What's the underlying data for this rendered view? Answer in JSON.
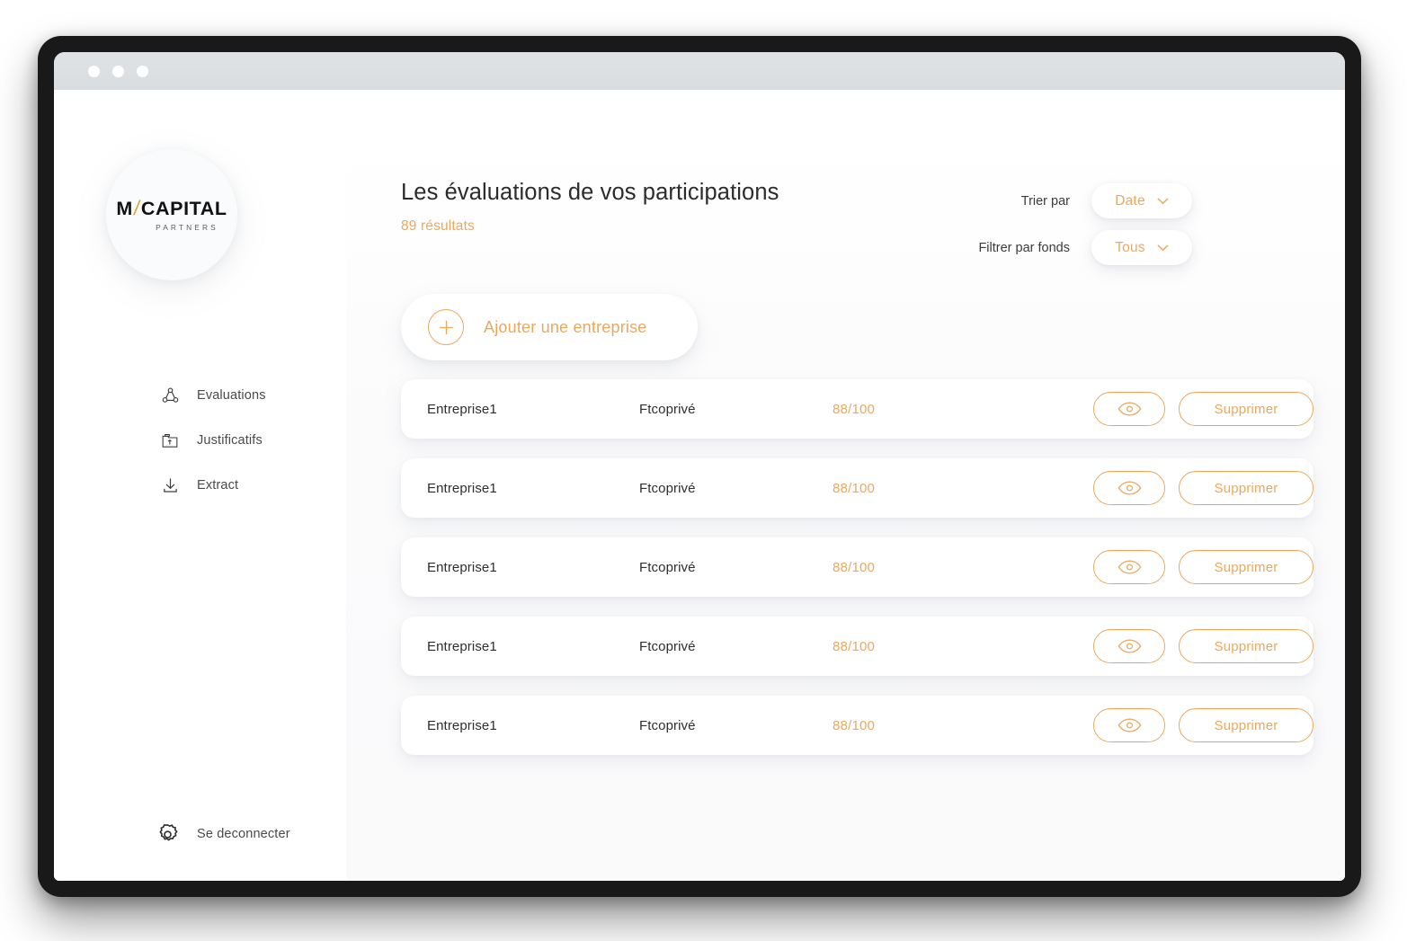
{
  "window": {
    "traffic_lights": [
      "close",
      "minimize",
      "maximize"
    ]
  },
  "brand": {
    "name_part1": "M",
    "slash": "/",
    "name_part2": "CAPITAL",
    "tagline": "PARTNERS",
    "slash_color": "#e0a13f"
  },
  "sidebar": {
    "items": [
      {
        "label": "Evaluations",
        "icon": "network-icon"
      },
      {
        "label": "Justificatifs",
        "icon": "folder-upload-icon"
      },
      {
        "label": "Extract",
        "icon": "download-icon"
      }
    ],
    "logout": {
      "label": "Se deconnecter",
      "icon": "gear-icon"
    }
  },
  "header": {
    "title": "Les évaluations de vos participations",
    "results": "89 résultats",
    "sort": {
      "label": "Trier par",
      "value": "Date"
    },
    "filter": {
      "label": "Filtrer par fonds",
      "value": "Tous"
    }
  },
  "actions": {
    "add_company": "Ajouter une entreprise"
  },
  "table": {
    "row_action_delete": "Supprimer",
    "rows": [
      {
        "name": "Entreprise1",
        "fund": "Ftcoprivé",
        "score": "88/100"
      },
      {
        "name": "Entreprise1",
        "fund": "Ftcoprivé",
        "score": "88/100"
      },
      {
        "name": "Entreprise1",
        "fund": "Ftcoprivé",
        "score": "88/100"
      },
      {
        "name": "Entreprise1",
        "fund": "Ftcoprivé",
        "score": "88/100"
      },
      {
        "name": "Entreprise1",
        "fund": "Ftcoprivé",
        "score": "88/100"
      }
    ]
  },
  "colors": {
    "accent": "#e8a95f",
    "text": "#2f2f2f",
    "frame": "#191919",
    "titlebar": "#d9dde0"
  }
}
